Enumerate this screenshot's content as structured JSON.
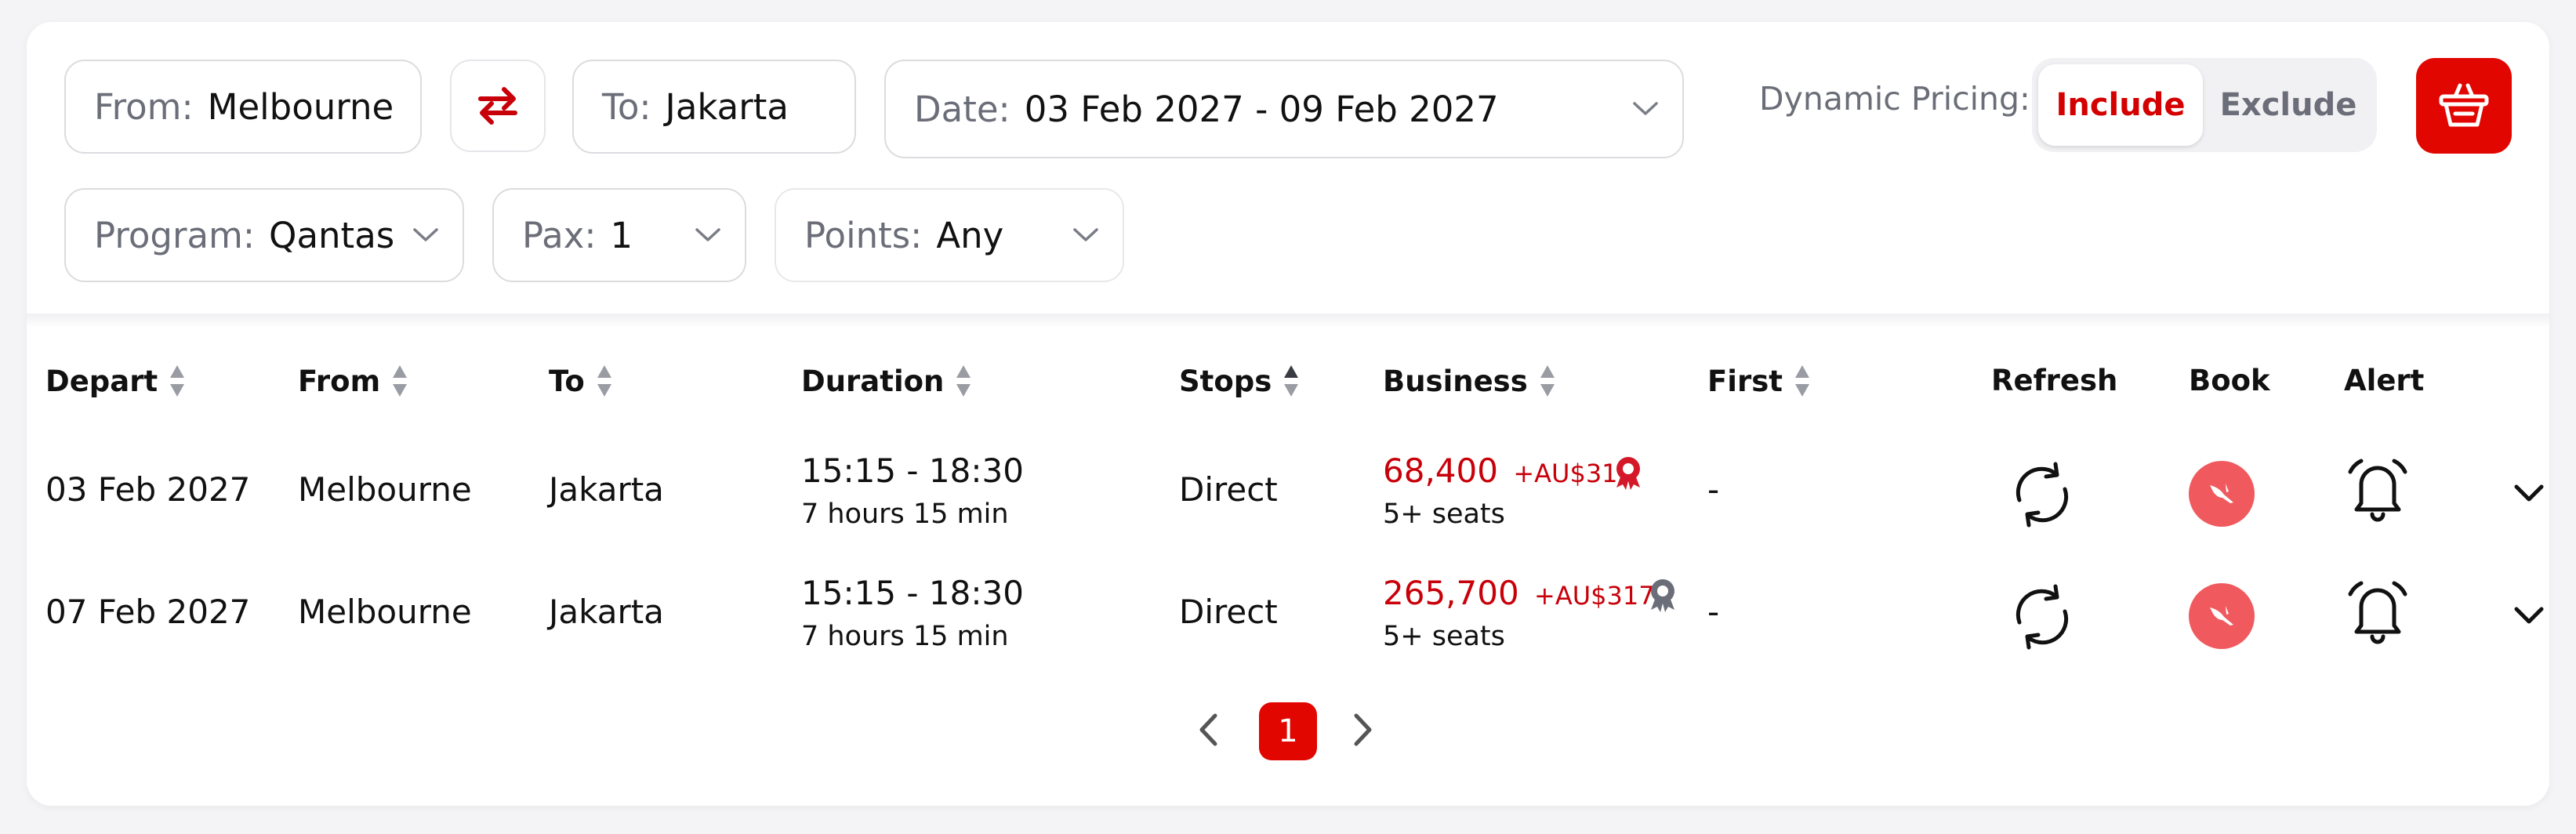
{
  "filters": {
    "from_label": "From:",
    "from_value": "Melbourne",
    "to_label": "To:",
    "to_value": "Jakarta",
    "date_label": "Date:",
    "date_value": "03 Feb 2027 - 09 Feb 2027",
    "dynamic_pricing_label": "Dynamic Pricing:",
    "include_label": "Include",
    "exclude_label": "Exclude",
    "dynamic_pricing_selected": "Include",
    "program_label": "Program:",
    "program_value": "Qantas",
    "pax_label": "Pax:",
    "pax_value": "1",
    "points_label": "Points:",
    "points_value": "Any"
  },
  "table": {
    "headers": {
      "depart": "Depart",
      "from": "From",
      "to": "To",
      "duration": "Duration",
      "stops": "Stops",
      "business": "Business",
      "first": "First",
      "refresh": "Refresh",
      "book": "Book",
      "alert": "Alert"
    },
    "rows": [
      {
        "depart": "03 Feb 2027",
        "from": "Melbourne",
        "to": "Jakarta",
        "time": "15:15 - 18:30",
        "duration": "7 hours 15 min",
        "stops": "Direct",
        "business_points": "68,400",
        "business_tax": "+AU$317",
        "business_seats": "5+ seats",
        "first": "-",
        "badge_color": "#d4182a"
      },
      {
        "depart": "07 Feb 2027",
        "from": "Melbourne",
        "to": "Jakarta",
        "time": "15:15 - 18:30",
        "duration": "7 hours 15 min",
        "stops": "Direct",
        "business_points": "265,700",
        "business_tax": "+AU$317",
        "business_seats": "5+ seats",
        "first": "-",
        "badge_color": "#6b6e78"
      }
    ]
  },
  "pagination": {
    "current_page": "1"
  },
  "colors": {
    "accent": "#e10600",
    "price_red": "#c8000a",
    "book_circle": "#f05a5e"
  }
}
